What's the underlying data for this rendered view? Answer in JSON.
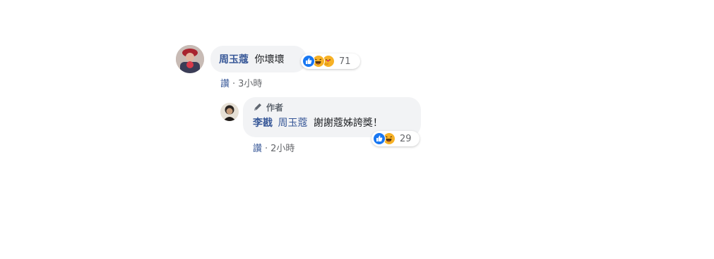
{
  "comment": {
    "author_name": "周玉蔻",
    "text": "你壞壞",
    "reaction_count": "71",
    "like_label": "讚",
    "separator": "·",
    "time": "3小時"
  },
  "reply": {
    "author_badge": "作者",
    "author_name": "李戡",
    "mention": "周玉蔻",
    "text": "謝謝蔻姊誇獎！",
    "reaction_count": "29",
    "like_label": "讚",
    "separator": "·",
    "time": "2小時"
  },
  "colors": {
    "name_link": "#385898",
    "bubble_bg": "#f2f3f5",
    "meta_text": "#65676b",
    "like_blue": "#1877f2",
    "emoji_yellow": "#f7b125"
  }
}
